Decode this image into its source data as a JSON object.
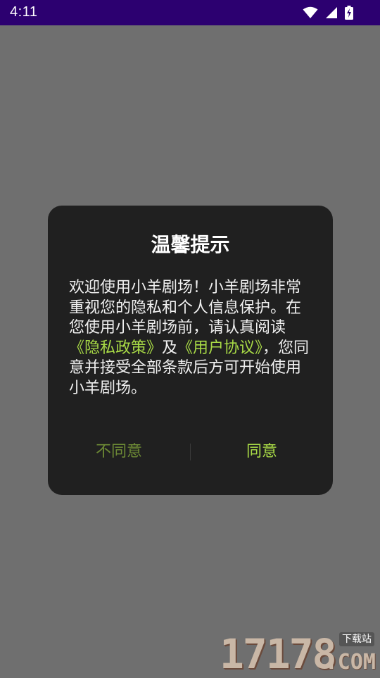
{
  "status_bar": {
    "time": "4:11",
    "icons": [
      "wifi-icon",
      "cellular-signal-icon",
      "battery-charging-icon"
    ],
    "background": "#2c0070"
  },
  "dialog": {
    "title": "温馨提示",
    "message": {
      "part1": "欢迎使用小羊剧场！小羊剧场非常重视您的隐私和个人信息保护。在您使用小羊剧场前，请认真阅读",
      "privacy_link": "《隐私政策》",
      "part2": "及",
      "agreement_link": "《用户协议》",
      "part3": "，您同意并接受全部条款后方可开始使用小羊剧场。"
    },
    "disagree_label": "不同意",
    "agree_label": "同意",
    "accent_color": "#a9db46",
    "background": "#202020"
  },
  "watermark": {
    "number": "17178",
    "subtitle": "下载站",
    "domain": ".COM"
  }
}
